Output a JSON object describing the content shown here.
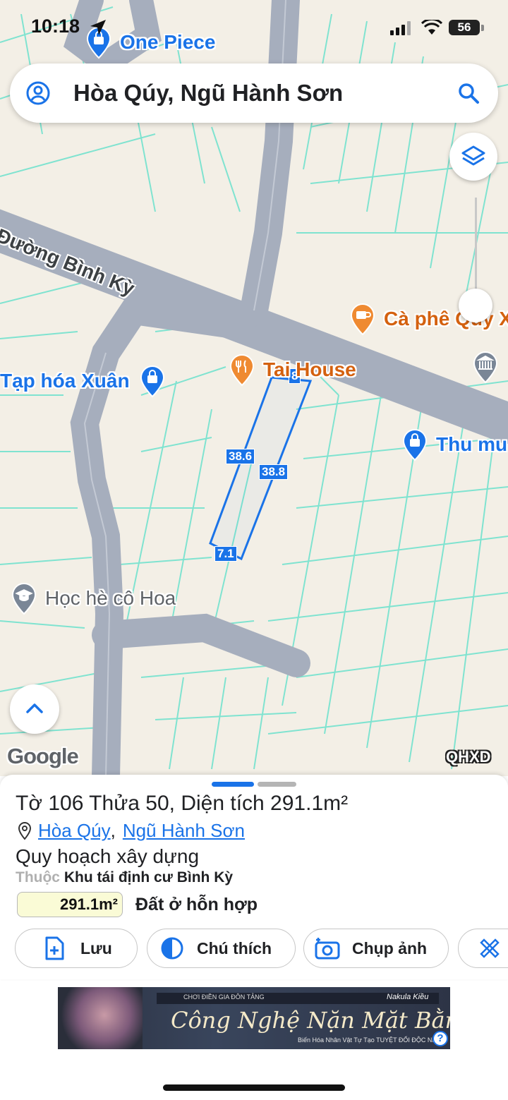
{
  "status_bar": {
    "time": "10:18",
    "battery": "56"
  },
  "search": {
    "query": "Hòa Qúy, Ngũ Hành Sơn"
  },
  "map": {
    "road_label": "Đường Bình Kỳ",
    "pois": [
      {
        "name": "One Piece",
        "icon": "shopping-bag-icon"
      },
      {
        "name": "Cà phê Qúy X",
        "icon": "coffee-icon"
      },
      {
        "name": "Tai House",
        "icon": "restaurant-icon"
      },
      {
        "name": "Tạp hóa Xuân",
        "icon": "shopping-bag-icon"
      },
      {
        "name": "Thu mu",
        "icon": "shopping-bag-icon"
      },
      {
        "name": "Học hè cô Hoa",
        "icon": "school-icon"
      }
    ],
    "dimensions": {
      "top": "8",
      "left_side": "38.6",
      "right_side": "38.8",
      "bottom": "7.1"
    },
    "google_logo": "Google",
    "layer_tag": "QHXD",
    "colors": {
      "parcel_line": "#1a73e8",
      "boundary": "#7fe3d0",
      "road": "#a6aebd"
    }
  },
  "sheet": {
    "title": "Tờ 106 Thửa 50, Diện tích 291.1m²",
    "ward": "Hòa Qúy",
    "district": "Ngũ Hành Sơn",
    "plan_title": "Quy hoạch xây dựng",
    "zone_prefix": "Thuộc",
    "zone_name": "Khu tái định cư Bình Kỳ",
    "area": "291.1m²",
    "land_type": "Đất ở hỗn hợp",
    "actions": [
      {
        "label": "Lưu",
        "icon": "add-file-icon"
      },
      {
        "label": "Chú thích",
        "icon": "half-circle-icon"
      },
      {
        "label": "Chụp ảnh",
        "icon": "camera-icon"
      },
      {
        "label": "",
        "icon": "measure-tool-icon"
      }
    ]
  },
  "ad": {
    "top_bar_text": "CHƠI ĐIỀN GIA ĐÔN TẢNG",
    "brand": "Nakula Kiều",
    "headline": "Công Nghệ Nặn Mặt Bằng Ai",
    "subline": "Biến Hóa Nhân Vật Tự Tạo TUYỆT ĐỐI ĐỘC NHẤT",
    "help": "?"
  }
}
